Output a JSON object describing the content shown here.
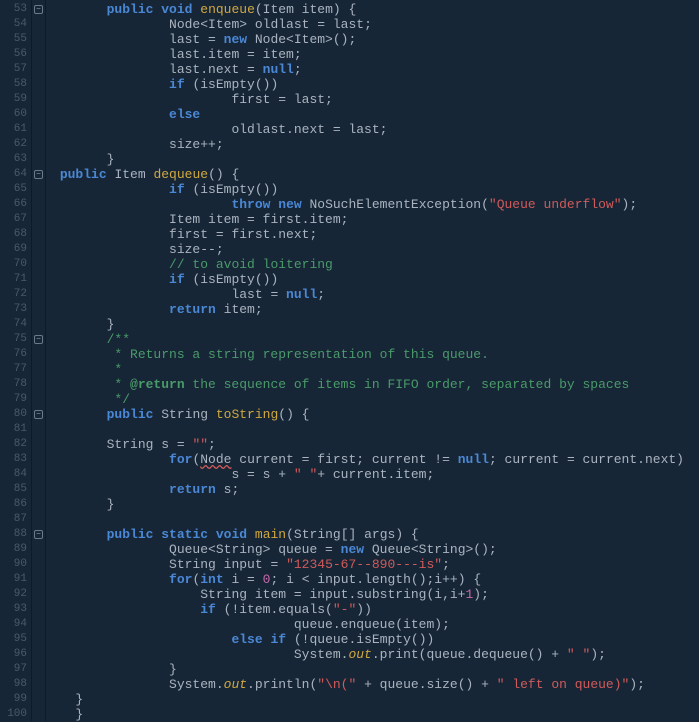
{
  "startLine": 53,
  "endLine": 100,
  "foldLines": [
    53,
    64,
    75,
    80,
    88
  ],
  "code": [
    {
      "indent": 1,
      "tokens": [
        {
          "t": "kw",
          "v": "public"
        },
        {
          "t": "sp"
        },
        {
          "t": "kw",
          "v": "void"
        },
        {
          "t": "sp"
        },
        {
          "t": "method",
          "v": "enqueue"
        },
        {
          "t": "op",
          "v": "(Item item) {"
        }
      ]
    },
    {
      "indent": 3,
      "tokens": [
        {
          "t": "id",
          "v": "Node<Item> oldlast = last;"
        }
      ]
    },
    {
      "indent": 3,
      "tokens": [
        {
          "t": "id",
          "v": "last = "
        },
        {
          "t": "new",
          "v": "new"
        },
        {
          "t": "id",
          "v": " Node<Item>();"
        }
      ]
    },
    {
      "indent": 3,
      "tokens": [
        {
          "t": "id",
          "v": "last.item = item;"
        }
      ]
    },
    {
      "indent": 3,
      "tokens": [
        {
          "t": "id",
          "v": "last.next = "
        },
        {
          "t": "null",
          "v": "null"
        },
        {
          "t": "op",
          "v": ";"
        }
      ]
    },
    {
      "indent": 3,
      "tokens": [
        {
          "t": "kw",
          "v": "if"
        },
        {
          "t": "id",
          "v": " (isEmpty())"
        }
      ]
    },
    {
      "indent": 5,
      "tokens": [
        {
          "t": "id",
          "v": "first = last;"
        }
      ]
    },
    {
      "indent": 3,
      "tokens": [
        {
          "t": "kw",
          "v": "else"
        }
      ]
    },
    {
      "indent": 5,
      "tokens": [
        {
          "t": "id",
          "v": "oldlast.next = last;"
        }
      ]
    },
    {
      "indent": 3,
      "tokens": [
        {
          "t": "id",
          "v": "size++;"
        }
      ]
    },
    {
      "indent": 1,
      "tokens": [
        {
          "t": "op",
          "v": "}"
        }
      ]
    },
    {
      "indent": 0,
      "sp": " ",
      "tokens": [
        {
          "t": "kw",
          "v": "public"
        },
        {
          "t": "sp"
        },
        {
          "t": "id",
          "v": "Item "
        },
        {
          "t": "method",
          "v": "dequeue"
        },
        {
          "t": "op",
          "v": "() {"
        }
      ]
    },
    {
      "indent": 3,
      "tokens": [
        {
          "t": "kw",
          "v": "if"
        },
        {
          "t": "id",
          "v": " (isEmpty())"
        }
      ]
    },
    {
      "indent": 5,
      "tokens": [
        {
          "t": "kw",
          "v": "throw"
        },
        {
          "t": "sp"
        },
        {
          "t": "new",
          "v": "new"
        },
        {
          "t": "id",
          "v": " NoSuchElementException("
        },
        {
          "t": "str",
          "v": "\"Queue underflow\""
        },
        {
          "t": "op",
          "v": ");"
        }
      ]
    },
    {
      "indent": 3,
      "tokens": [
        {
          "t": "id",
          "v": "Item item = first.item;"
        }
      ]
    },
    {
      "indent": 3,
      "tokens": [
        {
          "t": "id",
          "v": "first = first.next;"
        }
      ]
    },
    {
      "indent": 3,
      "tokens": [
        {
          "t": "id",
          "v": "size--;"
        }
      ]
    },
    {
      "indent": 3,
      "tokens": [
        {
          "t": "cmt",
          "v": "// to avoid loitering"
        }
      ]
    },
    {
      "indent": 3,
      "tokens": [
        {
          "t": "kw",
          "v": "if"
        },
        {
          "t": "id",
          "v": " (isEmpty())"
        }
      ]
    },
    {
      "indent": 5,
      "tokens": [
        {
          "t": "id",
          "v": "last = "
        },
        {
          "t": "null",
          "v": "null"
        },
        {
          "t": "op",
          "v": ";"
        }
      ]
    },
    {
      "indent": 3,
      "tokens": [
        {
          "t": "kw",
          "v": "return"
        },
        {
          "t": "id",
          "v": " item;"
        }
      ]
    },
    {
      "indent": 1,
      "tokens": [
        {
          "t": "op",
          "v": "}"
        }
      ]
    },
    {
      "indent": 1,
      "tokens": [
        {
          "t": "cmt",
          "v": "/**"
        }
      ]
    },
    {
      "indent": 1,
      "tokens": [
        {
          "t": "cmt",
          "v": " * Returns a string representation of this queue."
        }
      ]
    },
    {
      "indent": 1,
      "tokens": [
        {
          "t": "cmt",
          "v": " *"
        }
      ]
    },
    {
      "indent": 1,
      "tokens": [
        {
          "t": "cmt",
          "v": " * "
        },
        {
          "t": "cmt",
          "v": "@return",
          "b": true
        },
        {
          "t": "cmt",
          "v": " the sequence of items in FIFO order, separated by spaces"
        }
      ]
    },
    {
      "indent": 1,
      "tokens": [
        {
          "t": "cmt",
          "v": " */"
        }
      ]
    },
    {
      "indent": 1,
      "tokens": [
        {
          "t": "kw",
          "v": "public"
        },
        {
          "t": "sp"
        },
        {
          "t": "id",
          "v": "String "
        },
        {
          "t": "method",
          "v": "toString"
        },
        {
          "t": "op",
          "v": "() {"
        }
      ]
    },
    {
      "indent": 0,
      "tokens": []
    },
    {
      "indent": 1,
      "tokens": [
        {
          "t": "id",
          "v": "String s = "
        },
        {
          "t": "str",
          "v": "\"\""
        },
        {
          "t": "op",
          "v": ";"
        }
      ]
    },
    {
      "indent": 3,
      "tokens": [
        {
          "t": "kw",
          "v": "for"
        },
        {
          "t": "op",
          "v": "("
        },
        {
          "t": "err",
          "v": "Node"
        },
        {
          "t": "id",
          "v": " current = first; current != "
        },
        {
          "t": "null",
          "v": "null"
        },
        {
          "t": "id",
          "v": "; current = current.next)"
        }
      ]
    },
    {
      "indent": 5,
      "tokens": [
        {
          "t": "id",
          "v": "s = s + "
        },
        {
          "t": "str",
          "v": "\" \""
        },
        {
          "t": "id",
          "v": "+ current.item;"
        }
      ]
    },
    {
      "indent": 3,
      "tokens": [
        {
          "t": "kw",
          "v": "return"
        },
        {
          "t": "id",
          "v": " s;"
        }
      ]
    },
    {
      "indent": 1,
      "tokens": [
        {
          "t": "op",
          "v": "}"
        }
      ]
    },
    {
      "indent": 0,
      "tokens": []
    },
    {
      "indent": 1,
      "tokens": [
        {
          "t": "kw",
          "v": "public"
        },
        {
          "t": "sp"
        },
        {
          "t": "kw",
          "v": "static"
        },
        {
          "t": "sp"
        },
        {
          "t": "kw",
          "v": "void"
        },
        {
          "t": "sp"
        },
        {
          "t": "method",
          "v": "main"
        },
        {
          "t": "op",
          "v": "(String[] args) {"
        }
      ]
    },
    {
      "indent": 3,
      "tokens": [
        {
          "t": "id",
          "v": "Queue<String> queue = "
        },
        {
          "t": "new",
          "v": "new"
        },
        {
          "t": "id",
          "v": " Queue<String>();"
        }
      ]
    },
    {
      "indent": 3,
      "tokens": [
        {
          "t": "id",
          "v": "String input = "
        },
        {
          "t": "str",
          "v": "\"12345-67--890---is\""
        },
        {
          "t": "op",
          "v": ";"
        }
      ]
    },
    {
      "indent": 3,
      "tokens": [
        {
          "t": "kw",
          "v": "for"
        },
        {
          "t": "op",
          "v": "("
        },
        {
          "t": "kw",
          "v": "int"
        },
        {
          "t": "id",
          "v": " i = "
        },
        {
          "t": "num",
          "v": "0"
        },
        {
          "t": "id",
          "v": "; i < input.length();i++) {"
        }
      ]
    },
    {
      "indent": 4,
      "tokens": [
        {
          "t": "id",
          "v": "String item = input.substring(i,i+"
        },
        {
          "t": "num",
          "v": "1"
        },
        {
          "t": "op",
          "v": ");"
        }
      ]
    },
    {
      "indent": 4,
      "tokens": [
        {
          "t": "kw",
          "v": "if"
        },
        {
          "t": "id",
          "v": " (!item.equals("
        },
        {
          "t": "str",
          "v": "\"-\""
        },
        {
          "t": "op",
          "v": "))"
        }
      ]
    },
    {
      "indent": 7,
      "tokens": [
        {
          "t": "id",
          "v": "queue.enqueue(item);"
        }
      ]
    },
    {
      "indent": 5,
      "tokens": [
        {
          "t": "kw",
          "v": "else"
        },
        {
          "t": "sp"
        },
        {
          "t": "kw",
          "v": "if"
        },
        {
          "t": "id",
          "v": " (!queue.isEmpty())"
        }
      ]
    },
    {
      "indent": 7,
      "tokens": [
        {
          "t": "id",
          "v": "System."
        },
        {
          "t": "static",
          "v": "out"
        },
        {
          "t": "id",
          "v": ".print(queue.dequeue() + "
        },
        {
          "t": "str",
          "v": "\" \""
        },
        {
          "t": "op",
          "v": ");"
        }
      ]
    },
    {
      "indent": 3,
      "tokens": [
        {
          "t": "op",
          "v": "}"
        }
      ]
    },
    {
      "indent": 3,
      "tokens": [
        {
          "t": "id",
          "v": "System."
        },
        {
          "t": "static",
          "v": "out"
        },
        {
          "t": "id",
          "v": ".println("
        },
        {
          "t": "str",
          "v": "\"\\n(\""
        },
        {
          "t": "id",
          "v": " + queue.size() + "
        },
        {
          "t": "str",
          "v": "\" left on queue)\""
        },
        {
          "t": "op",
          "v": ");"
        }
      ]
    },
    {
      "indent": 0,
      "sp": "  ",
      "tokens": [
        {
          "t": "op",
          "v": " }"
        }
      ]
    },
    {
      "indent": 0,
      "tokens": [
        {
          "t": "op",
          "v": "}"
        }
      ]
    }
  ]
}
